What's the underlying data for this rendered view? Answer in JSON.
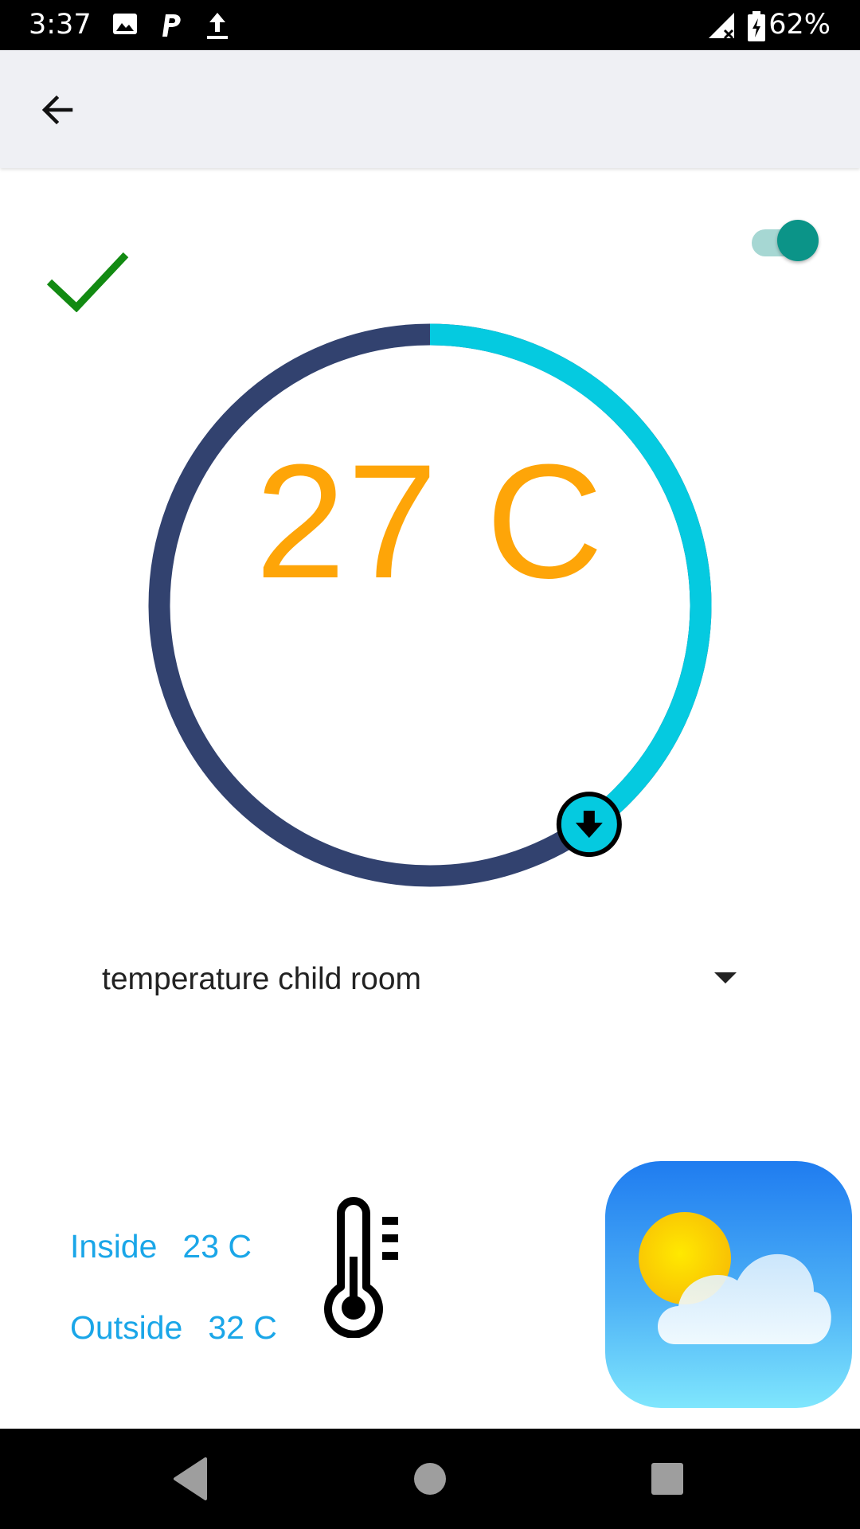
{
  "status_bar": {
    "time": "3:37",
    "battery": "62%",
    "icons": [
      "image-icon",
      "parking-icon",
      "upload-icon",
      "signal-off-icon",
      "battery-charging-icon"
    ]
  },
  "app_bar": {
    "back_icon": "arrow-back-icon"
  },
  "control": {
    "confirmed_icon": "checkmark-icon",
    "confirmed_color": "#128a12",
    "toggle_on": true,
    "toggle_color": "#0b9488",
    "setpoint": "27 C",
    "dial_progress_fraction": 0.4,
    "dial_track_color": "#32426f",
    "dial_progress_color": "#05cae0",
    "handle_icon": "arrow-down-icon",
    "text_color": "#fea508"
  },
  "room_select": {
    "selected": "temperature child room",
    "arrow_icon": "dropdown-arrow-icon"
  },
  "readings": {
    "inside_label": "Inside",
    "inside_value": "23 C",
    "outside_label": "Outside",
    "outside_value": "32 C",
    "color": "#1aa6e8",
    "thermometer_icon": "thermometer-icon",
    "weather_icon": "weather-partly-cloudy-icon"
  },
  "nav_bar": {
    "icons": [
      "nav-back-icon",
      "nav-home-icon",
      "nav-recents-icon"
    ]
  }
}
